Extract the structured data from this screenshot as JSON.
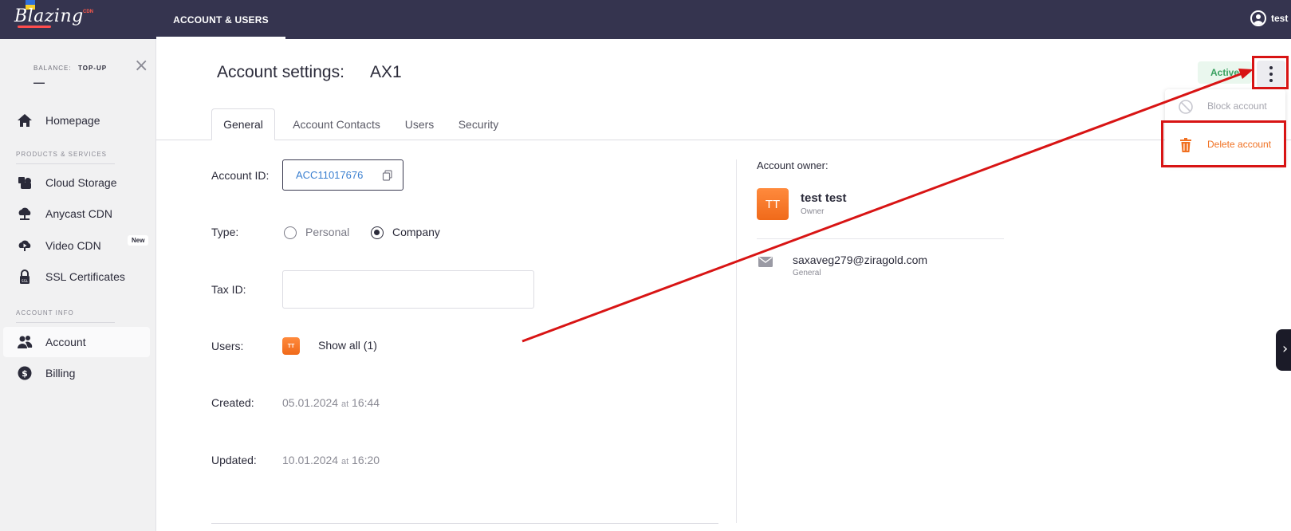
{
  "header": {
    "logo_text": "Blazing",
    "logo_sup": "CDN",
    "nav_tab": "ACCOUNT & USERS",
    "user_label": "test"
  },
  "sidebar": {
    "balance_label": "BALANCE:",
    "topup_label": "TOP-UP",
    "balance_value": "—",
    "close_symbol": "×",
    "items": [
      {
        "label": "Homepage",
        "icon": "home-icon"
      },
      {
        "label": "Cloud Storage",
        "icon": "cloud-storage-icon"
      },
      {
        "label": "Anycast CDN",
        "icon": "cloud-network-icon"
      },
      {
        "label": "Video CDN",
        "icon": "video-cloud-icon",
        "badge": "New"
      },
      {
        "label": "SSL Certificates",
        "icon": "lock-icon"
      },
      {
        "label": "Account",
        "icon": "users-icon",
        "active": true
      },
      {
        "label": "Billing",
        "icon": "dollar-icon"
      }
    ],
    "sections": [
      "PRODUCTS & SERVICES",
      "ACCOUNT INFO"
    ]
  },
  "page": {
    "title": "Account settings:",
    "account_name": "AX1",
    "status": "Active",
    "tabs": [
      "General",
      "Account Contacts",
      "Users",
      "Security"
    ]
  },
  "general": {
    "account_id_label": "Account ID:",
    "account_id": "ACC11017676",
    "type_label": "Type:",
    "type_options": [
      "Personal",
      "Company"
    ],
    "type_selected": "Company",
    "tax_id_label": "Tax ID:",
    "tax_id_value": "",
    "users_label": "Users:",
    "users_avatar": "TT",
    "users_show_all": "Show all (1)",
    "created_label": "Created:",
    "created_date": "05.01.2024",
    "created_at": "at",
    "created_time": "16:44",
    "updated_label": "Updated:",
    "updated_date": "10.01.2024",
    "updated_at": "at",
    "updated_time": "16:20"
  },
  "owner": {
    "label": "Account owner:",
    "initials": "TT",
    "name": "test test",
    "role": "Owner",
    "email": "saxaveg279@ziragold.com",
    "email_type": "General"
  },
  "dropdown": {
    "items": [
      {
        "label": "Block account",
        "icon": "block-icon",
        "disabled": true
      },
      {
        "label": "Delete account",
        "icon": "trash-icon",
        "danger": true
      }
    ]
  },
  "colors": {
    "topbar": "#35344f",
    "accent_orange": "#f07021",
    "highlight_red": "#d81414",
    "active_green": "#3aa160",
    "link_blue": "#3a7fd0"
  }
}
